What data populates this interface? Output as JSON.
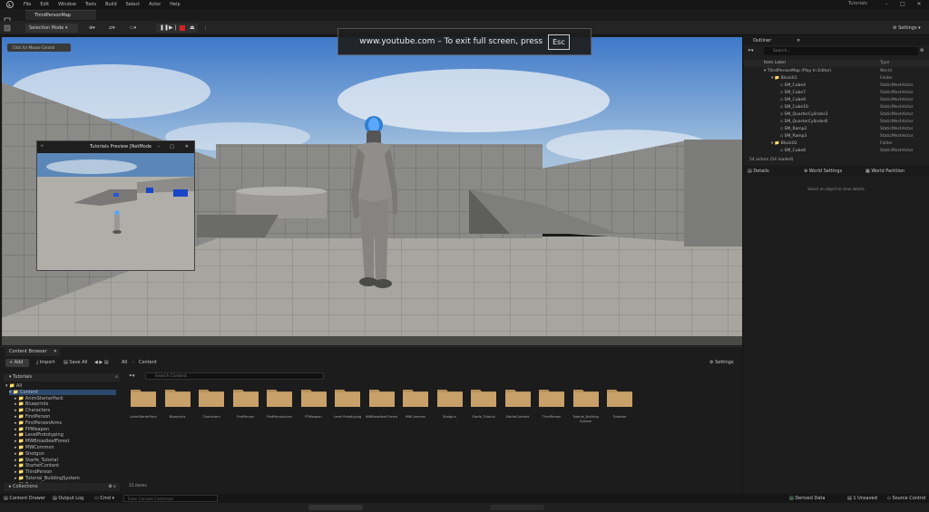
{
  "menubar": {
    "items": [
      "File",
      "Edit",
      "Window",
      "Tools",
      "Build",
      "Select",
      "Actor",
      "Help"
    ],
    "project": "Tutorials"
  },
  "tab": {
    "label": "ThirdPersonMap"
  },
  "toolbar": {
    "mode": "Selection Mode",
    "settings": "Settings"
  },
  "overlay": {
    "text": "www.youtube.com – To exit full screen, press",
    "key": "Esc"
  },
  "viewport": {
    "mouse_control": "Click for Mouse Control"
  },
  "preview": {
    "title": "Tutorials Preview [NetMode"
  },
  "outliner": {
    "title": "Outliner",
    "search_placeholder": "Search...",
    "col_label": "Item Label",
    "col_type": "Type",
    "rows": [
      {
        "label": "ThirdPersonMap (Play In Editor)",
        "type": "World"
      },
      {
        "label": "Block01",
        "type": "Folder"
      },
      {
        "label": "SM_Cube4",
        "type": "StaticMeshActor"
      },
      {
        "label": "SM_Cube7",
        "type": "StaticMeshActor"
      },
      {
        "label": "SM_Cube9",
        "type": "StaticMeshActor"
      },
      {
        "label": "SM_Cube10",
        "type": "StaticMeshActor"
      },
      {
        "label": "SM_QuarterCylinder3",
        "type": "StaticMeshActor"
      },
      {
        "label": "SM_QuarterCylinder6",
        "type": "StaticMeshActor"
      },
      {
        "label": "SM_Ramp2",
        "type": "StaticMeshActor"
      },
      {
        "label": "SM_Ramp3",
        "type": "StaticMeshActor"
      },
      {
        "label": "Block02",
        "type": "Folder"
      },
      {
        "label": "SM_Cube8",
        "type": "StaticMeshActor"
      }
    ],
    "count": "54 actors (54 loaded)"
  },
  "details": {
    "tab1": "Details",
    "tab2": "World Settings",
    "tab3": "World Partition",
    "empty": "Select an object to view details."
  },
  "content_browser": {
    "title": "Content Browser",
    "add": "Add",
    "import": "Import",
    "save_all": "Save All",
    "path_all": "All",
    "path_content": "Content",
    "settings": "Settings",
    "search_placeholder": "Search Content",
    "project": "Tutorials",
    "tree": [
      "All",
      "Content",
      "AnimStarterPack",
      "Blueprints",
      "Characters",
      "FirstPerson",
      "FirstPersonArms",
      "FPWeapon",
      "LevelPrototyping",
      "MWBroadleafForest",
      "MWCommon",
      "Shotgun",
      "Starfe_Tutorial",
      "StarterContent",
      "ThirdPerson",
      "Tutorial_BuildingSystem",
      "Tutorials"
    ],
    "folders": [
      "AnimStarterPack",
      "Blueprints",
      "Characters",
      "FirstPerson",
      "FirstPersonArms",
      "FPWeapon",
      "Level Prototyping",
      "MWBroadleaf Forest",
      "MWCommon",
      "Shotgun",
      "Starfe_Tutorial",
      "StarterContent",
      "ThirdPerson",
      "Tutorial_Building System",
      "Tutorials"
    ],
    "items_count": "15 items",
    "collections": "Collections"
  },
  "status": {
    "drawer": "Content Drawer",
    "log": "Output Log",
    "cmd": "Cmd",
    "cmd_placeholder": "Enter Console Command",
    "derived": "Derived Data",
    "unsaved": "1 Unsaved",
    "source": "Source Control"
  }
}
